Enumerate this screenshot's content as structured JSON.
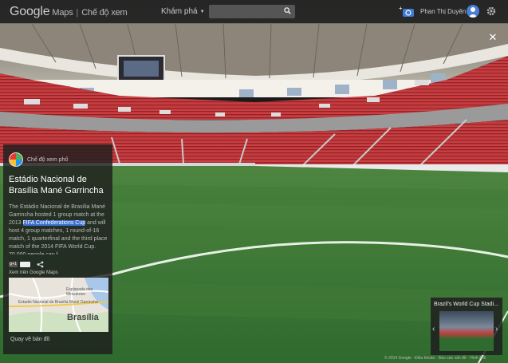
{
  "topbar": {
    "logo_google": "Google",
    "logo_maps": "Maps",
    "logo_sep": "|",
    "mode": "Chế độ xem",
    "explore": "Khám phá",
    "search_value": "",
    "search_placeholder": "",
    "username": "Phan Thị Duyên"
  },
  "panel": {
    "category": "Chế độ xem phố",
    "title": "Estádio Nacional de Brasília Mané Garrincha",
    "desc_before": "The Estádio Nacional de Brasília Mané Garrincha hosted 1 group match at the 2013 ",
    "desc_highlight": "FIFA Confederations Cup",
    "desc_after": " and will host 4 group matches, 1 round-of-16 match, 1 quarterfinal and the third place match of the 2014 FIFA World Cup. 70,000 people can f...",
    "gplus_label": "g+1",
    "count_label": "",
    "view_in_maps": "Xem trên Google Maps",
    "map_label_1": "Estadio Nacional de Brasília Mané Garrincha",
    "map_label_2": "Esplanada dos Ministérios",
    "map_city": "Brasília",
    "back_link": "Quay về bản đồ"
  },
  "thumbnail": {
    "label": "Brazil's World Cup Stadi..."
  },
  "footer": {
    "text": "© 2014 Google · Điều khoản · Báo cáo vấn đề · Hình ảnh"
  },
  "colors": {
    "seat_red": "#c8383c",
    "pitch_green": "#3c7a3a",
    "topbar": "#222222",
    "highlight": "#3b6fd1"
  },
  "icons": [
    "search-icon",
    "add-photo-icon",
    "avatar",
    "gear-icon",
    "close-icon",
    "share-icon",
    "chevron-left-icon",
    "chevron-right-icon"
  ]
}
